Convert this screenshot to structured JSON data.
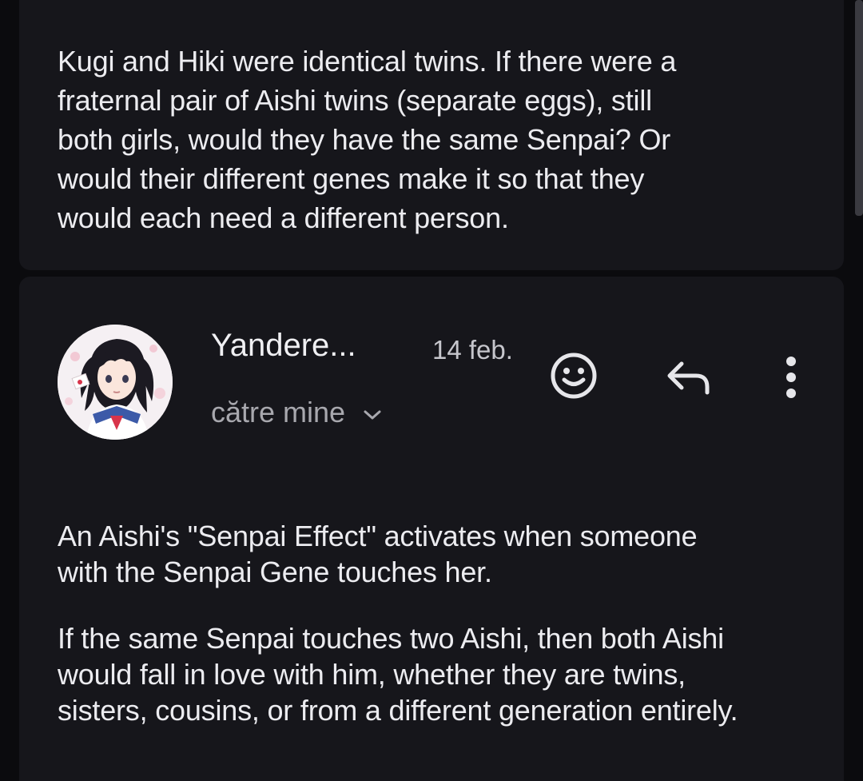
{
  "previous_message": {
    "body": "Kugi and Hiki were identical twins. If there were a\nfraternal pair of Aishi twins (separate eggs), still\nboth girls, would they have the same Senpai? Or\nwould their different genes make it so that they\nwould each need a different person."
  },
  "reply": {
    "sender": "Yandere...",
    "date": "14 feb.",
    "recipient": "către mine",
    "icons": {
      "avatar": "avatar-anime-girl",
      "emoji": "emoji-smile-icon",
      "reply": "reply-arrow-icon",
      "more": "more-vertical-icon",
      "expand": "chevron-down-icon"
    },
    "paragraphs": [
      "An Aishi's \"Senpai Effect\" activates when someone\nwith the Senpai Gene touches her.",
      "If the same Senpai touches two Aishi, then both Aishi\nwould fall in love with him, whether they are twins,\nsisters, cousins, or from a different generation entirely."
    ]
  },
  "colors": {
    "background": "#0b0b0e",
    "card": "#16161b",
    "text": "#ececf0",
    "secondary_text": "#a8a8ae"
  }
}
